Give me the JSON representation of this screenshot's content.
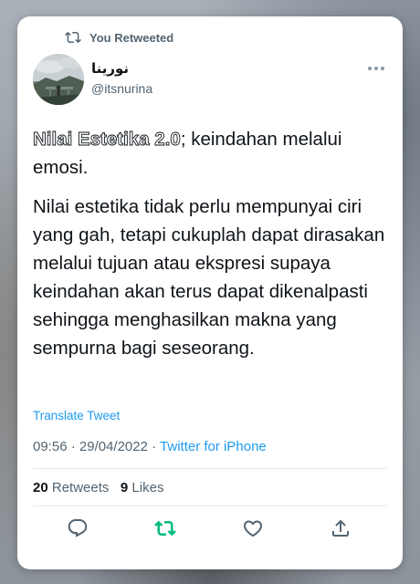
{
  "retweet_banner": {
    "label": "You Retweeted"
  },
  "author": {
    "display_name": "نورينا",
    "handle": "@itsnurina"
  },
  "tweet": {
    "title_outlined": "Nilai Estetika 2.0",
    "title_rest": "; keindahan melalui emosi.",
    "paragraph": "Nilai estetika tidak perlu mempunyai ciri yang gah, tetapi cukuplah dapat dirasakan melalui tujuan atau ekspresi supaya keindahan akan terus dapat dikenalpasti sehingga menghasilkan makna yang sempurna bagi seseorang."
  },
  "translate_label": "Translate Tweet",
  "meta": {
    "time": "09:56",
    "date": "29/04/2022",
    "separator1": " · ",
    "separator2": " · ",
    "source": "Twitter for iPhone"
  },
  "stats": {
    "retweets_count": "20",
    "retweets_label": "Retweets",
    "likes_count": "9",
    "likes_label": "Likes"
  },
  "colors": {
    "accent": "#1d9bf0",
    "retweet_green": "#00ba7c",
    "muted": "#536471",
    "text": "#0f1419"
  },
  "icons": [
    "retweet-icon",
    "more-icon",
    "reply-icon",
    "like-icon",
    "share-icon"
  ]
}
